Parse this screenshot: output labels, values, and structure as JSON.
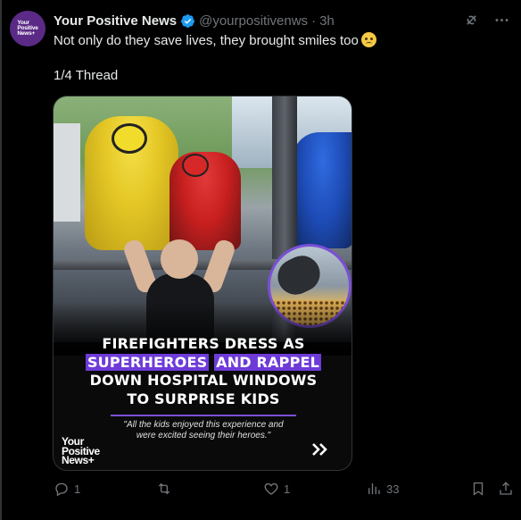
{
  "account": {
    "avatar_text": "Your Positive News+",
    "name": "Your Positive News",
    "handle": "@yourpositivenws",
    "separator": "·",
    "time": "3h"
  },
  "tweet": {
    "text": "Not only do they save lives, they brought smiles too",
    "emoji": "pleading-face-emoji",
    "thread_label": "1/4 Thread"
  },
  "media": {
    "headline_line1": "FIREFIGHTERS DRESS AS",
    "headline_line2a": "SUPERHEROES",
    "headline_line2b": "AND RAPPEL",
    "headline_line3": "DOWN HOSPITAL WINDOWS",
    "headline_line4": "TO SURPRISE KIDS",
    "quote_line1": "\"All the kids enjoyed this experience and",
    "quote_line2": "were excited seeing their heroes.\"",
    "brand_line1": "Your",
    "brand_line2": "Positive",
    "brand_line3": "News+",
    "highlight_color": "#6e3bd8"
  },
  "actions": {
    "reply_count": "1",
    "retweet_count": "",
    "like_count": "1",
    "views_count": "33"
  },
  "colors": {
    "background": "#000000",
    "text": "#e7e9ea",
    "muted": "#71767b",
    "verified": "#1d9bf0",
    "avatar": "#5b2a86"
  }
}
